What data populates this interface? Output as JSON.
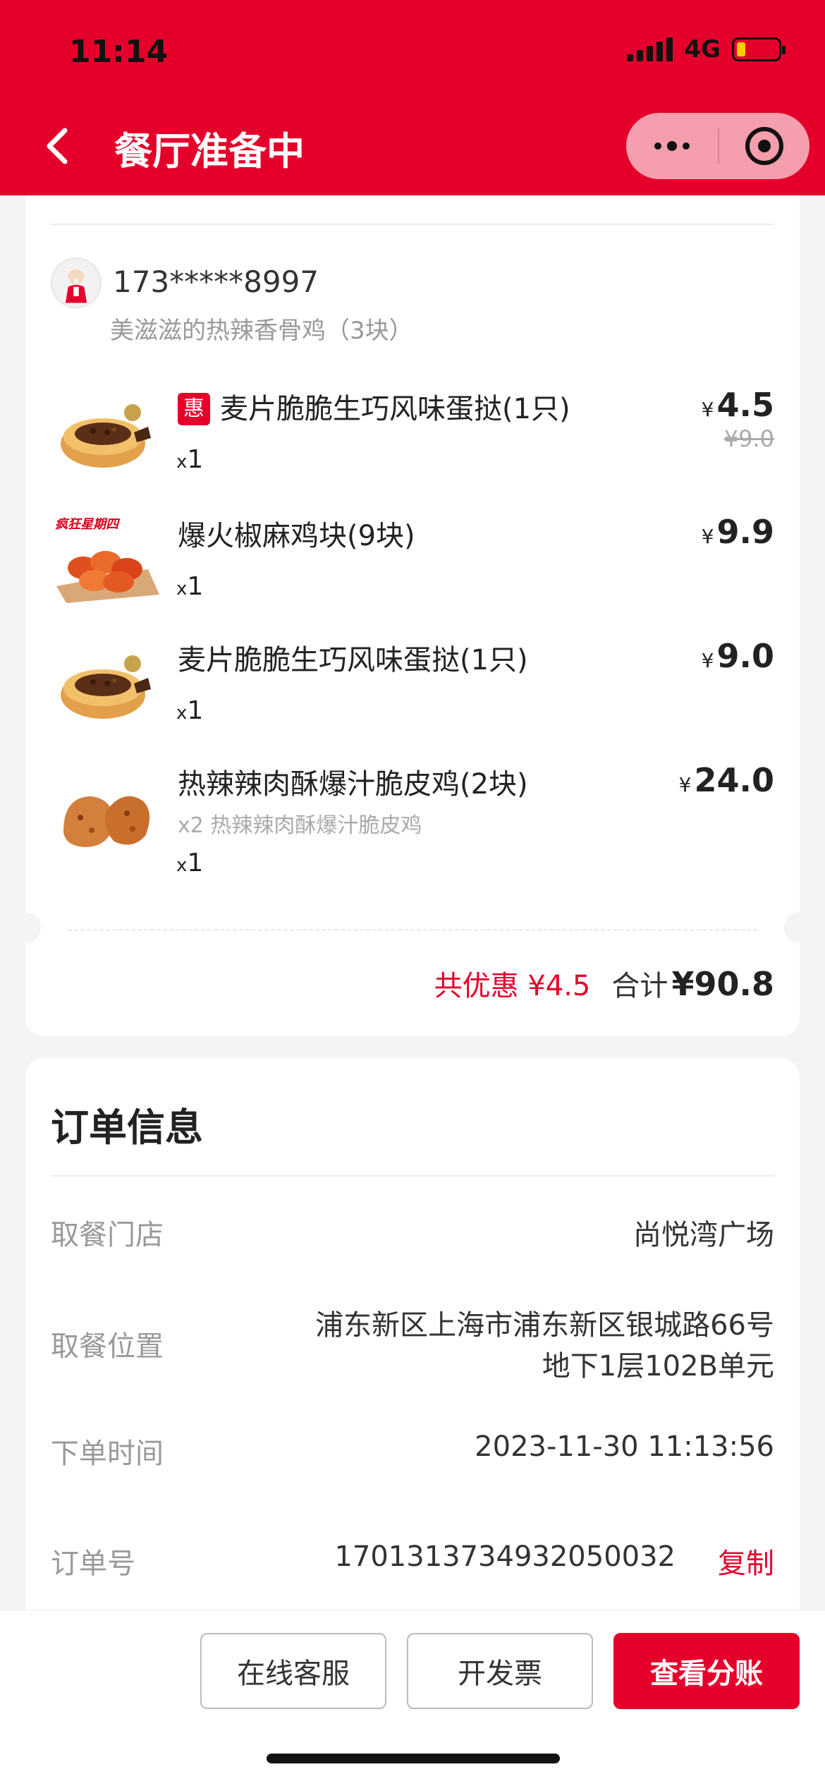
{
  "status_bar": {
    "time": "11:14",
    "network": "4G"
  },
  "nav": {
    "title": "餐厅准备中"
  },
  "user": {
    "phone": "173*****8997",
    "subtitle": "美滋滋的热辣香骨鸡（3块）"
  },
  "items": [
    {
      "badge": "惠",
      "name": "麦片脆脆生巧风味蛋挞(1只)",
      "qty_prefix": "x",
      "qty": "1",
      "currency": "¥",
      "price": "4.5",
      "original_price": "¥9.0",
      "icon": "egg-tart-image"
    },
    {
      "name": "爆火椒麻鸡块(9块)",
      "qty_prefix": "x",
      "qty": "1",
      "currency": "¥",
      "price": "9.9",
      "icon": "chicken-nuggets-image",
      "image_caption": "疯狂星期四"
    },
    {
      "name": "麦片脆脆生巧风味蛋挞(1只)",
      "qty_prefix": "x",
      "qty": "1",
      "currency": "¥",
      "price": "9.0",
      "icon": "egg-tart-image"
    },
    {
      "name": "热辣辣肉酥爆汁脆皮鸡(2块)",
      "sub": "x2 热辣辣肉酥爆汁脆皮鸡",
      "qty_prefix": "x",
      "qty": "1",
      "currency": "¥",
      "price": "24.0",
      "icon": "fried-chicken-image"
    }
  ],
  "summary": {
    "discount": "共优惠 ¥4.5",
    "total_label": "合计",
    "total_value": "¥90.8"
  },
  "order_info": {
    "title": "订单信息",
    "store_label": "取餐门店",
    "store_value": "尚悦湾广场",
    "location_label": "取餐位置",
    "location_line1": "浦东新区上海市浦东新区银城路66号",
    "location_line2": "地下1层102B单元",
    "time_label": "下单时间",
    "time_value": "2023-11-30 11:13:56",
    "order_no_label": "订单号",
    "order_no_value": "1701313734932050032",
    "copy_label": "复制"
  },
  "bottom_bar": {
    "service": "在线客服",
    "invoice": "开发票",
    "split": "查看分账"
  },
  "colors": {
    "brand": "#e4002b",
    "text": "#222222",
    "muted": "#999999",
    "background": "#f4f4f4"
  }
}
